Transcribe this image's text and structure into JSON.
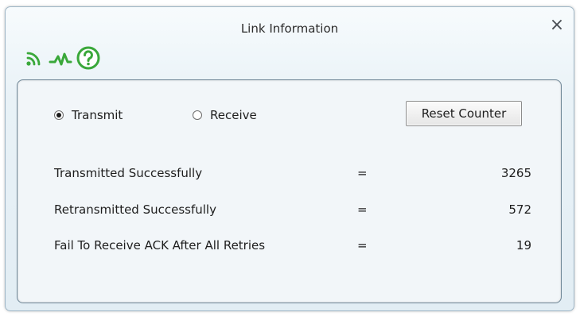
{
  "window": {
    "title": "Link Information",
    "close_glyph": "×"
  },
  "toolbar": {
    "icons": [
      "signal-icon",
      "activity-icon",
      "help-icon"
    ]
  },
  "mode": {
    "transmit_label": "Transmit",
    "receive_label": "Receive",
    "selected": "Transmit"
  },
  "reset_button_label": "Reset Counter",
  "stats": [
    {
      "label": "Transmitted Successfully",
      "eq": "=",
      "value": "3265"
    },
    {
      "label": "Retransmitted Successfully",
      "eq": "=",
      "value": "572"
    },
    {
      "label": "Fail To Receive ACK After All Retries",
      "eq": "=",
      "value": "19"
    }
  ],
  "colors": {
    "icon_green": "#3aa83a",
    "window_bg": "#e6eff5",
    "panel_border": "#6f8797"
  }
}
